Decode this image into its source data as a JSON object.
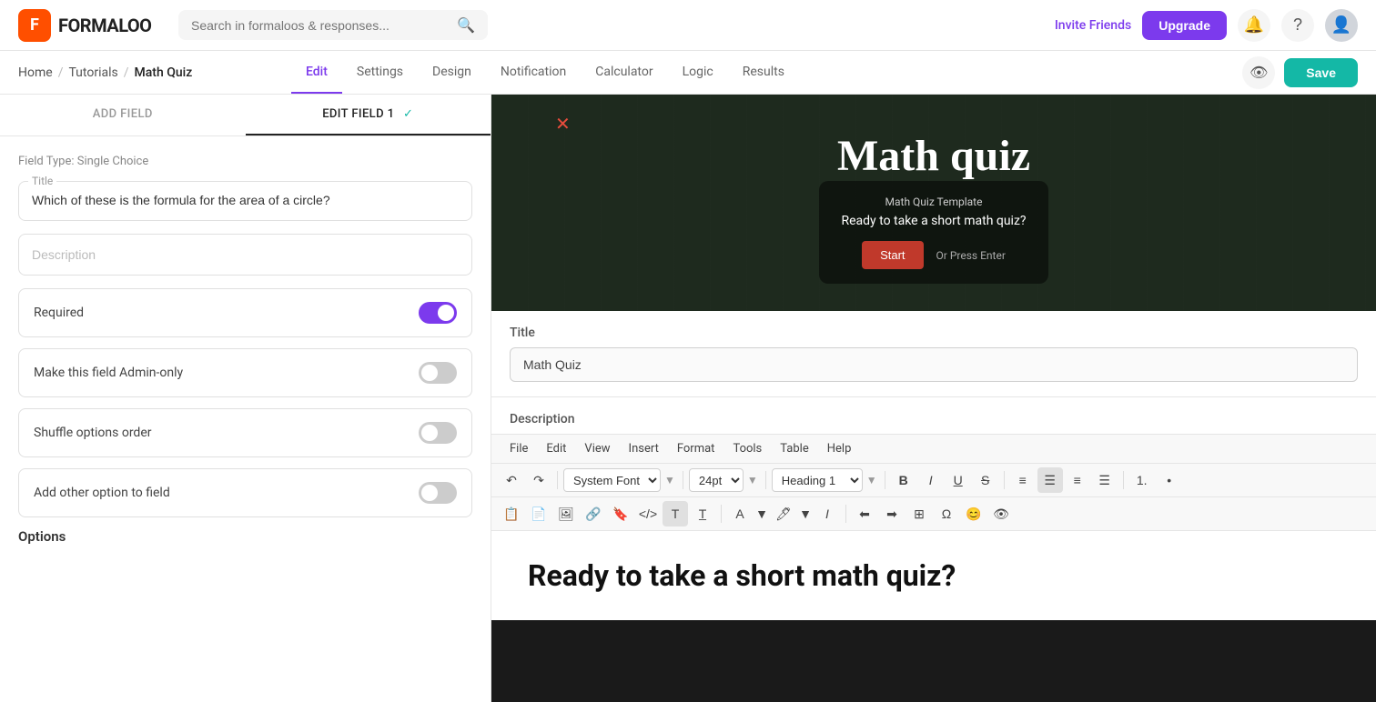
{
  "app": {
    "logo_letter": "F",
    "logo_name": "FORMALOO"
  },
  "top_nav": {
    "search_placeholder": "Search in formaloos & responses...",
    "invite_label": "Invite Friends",
    "upgrade_label": "Upgrade"
  },
  "breadcrumb": {
    "home": "Home",
    "tutorials": "Tutorials",
    "current": "Math Quiz"
  },
  "tabs": [
    {
      "id": "edit",
      "label": "Edit",
      "active": true
    },
    {
      "id": "settings",
      "label": "Settings",
      "active": false
    },
    {
      "id": "design",
      "label": "Design",
      "active": false
    },
    {
      "id": "notification",
      "label": "Notification",
      "active": false
    },
    {
      "id": "calculator",
      "label": "Calculator",
      "active": false
    },
    {
      "id": "logic",
      "label": "Logic",
      "active": false
    },
    {
      "id": "results",
      "label": "Results",
      "active": false
    }
  ],
  "save_label": "Save",
  "left_panel": {
    "tab_add": "ADD FIELD",
    "tab_edit": "EDIT FIELD 1",
    "field_type": "Field Type: Single Choice",
    "title_label": "Title",
    "title_value": "Which of these is the formula for the area of a circle?",
    "description_placeholder": "Description",
    "required_label": "Required",
    "required_on": true,
    "admin_only_label": "Make this field Admin-only",
    "admin_only_on": false,
    "shuffle_label": "Shuffle options order",
    "shuffle_on": false,
    "other_option_label": "Add other option to field",
    "other_option_on": false,
    "options_label": "Options"
  },
  "right_panel": {
    "quiz_title": "Math quiz",
    "preview_card_title": "Math Quiz Template",
    "preview_card_subtitle": "Ready to take a short math quiz?",
    "start_btn": "Start",
    "enter_text": "Or Press Enter",
    "editor": {
      "title_label": "Title",
      "title_value": "Math Quiz",
      "desc_label": "Description",
      "menu_items": [
        "File",
        "Edit",
        "View",
        "Insert",
        "Format",
        "Tools",
        "Table",
        "Help"
      ],
      "font_family": "System Font",
      "font_size": "24pt",
      "heading": "Heading 1",
      "content_heading": "Ready to take a short math quiz?"
    }
  },
  "toolbar": {
    "undo": "↶",
    "redo": "↷",
    "bold": "B",
    "italic": "I",
    "underline": "U",
    "strikethrough": "S",
    "align_left": "≡",
    "align_center": "≡",
    "align_right": "≡",
    "align_justify": "≡"
  }
}
